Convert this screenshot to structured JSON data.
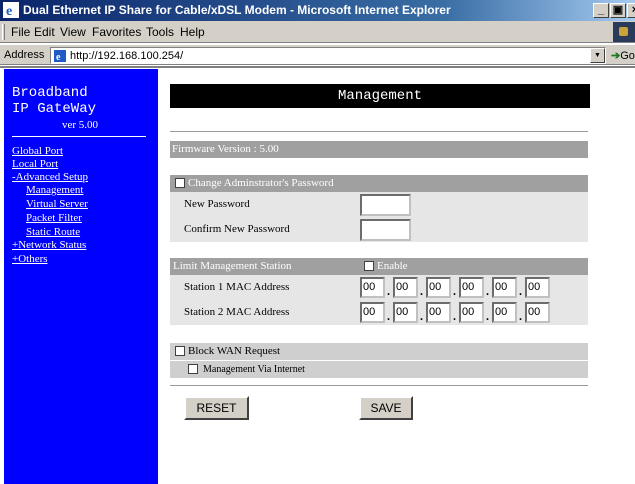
{
  "window": {
    "title": "Dual Ethernet IP Share for Cable/xDSL Modem - Microsoft Internet Explorer",
    "minimize": "_",
    "maximize": "▣",
    "close": "×"
  },
  "menu": [
    "File",
    "Edit",
    "View",
    "Favorites",
    "Tools",
    "Help"
  ],
  "address": {
    "label": "Address",
    "url": "http://192.168.100.254/",
    "go": "Go"
  },
  "nav": {
    "brand_line1": "Broadband",
    "brand_line2": "IP GateWay",
    "version": "ver 5.00",
    "links": {
      "global_port": "Global Port",
      "local_port": "Local Port",
      "advanced_setup": "-Advanced Setup",
      "management": "Management",
      "virtual_server": "Virtual Server",
      "packet_filter": "Packet Filter",
      "static_route": "Static Route",
      "network_status": "+Network Status",
      "others": "+Others"
    }
  },
  "main": {
    "heading": "Management",
    "firmware": "Firmware Version : 5.00",
    "password": {
      "section": "Change Adminstrator's Password",
      "checked": false,
      "new_label": "New Password",
      "confirm_label": "Confirm New Password",
      "new_value": "",
      "confirm_value": ""
    },
    "station": {
      "section": "Limit Management Station",
      "enable_label": "Enable",
      "enable_checked": false,
      "mac1_label": "Station 1 MAC Address",
      "mac2_label": "Station 2 MAC Address",
      "mac1": [
        "00",
        "00",
        "00",
        "00",
        "00",
        "00"
      ],
      "mac2": [
        "00",
        "00",
        "00",
        "00",
        "00",
        "00"
      ],
      "separator": "."
    },
    "wan": {
      "block_label": "Block WAN Request",
      "block_checked": false,
      "via_internet_label": "Management Via Internet",
      "via_internet_checked": false
    },
    "buttons": {
      "reset": "RESET",
      "save": "SAVE"
    }
  }
}
